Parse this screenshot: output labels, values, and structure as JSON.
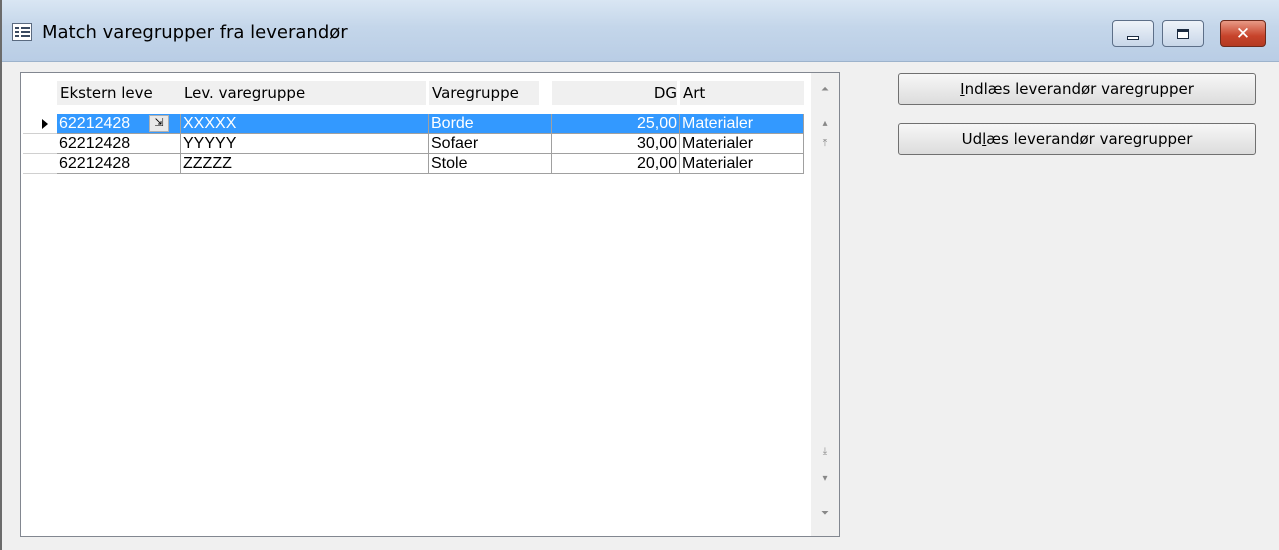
{
  "window": {
    "title": "Match varegrupper fra leverandør",
    "icon": "form-icon",
    "controls": {
      "minimize": "minimize-icon",
      "maximize": "maximize-icon",
      "close": "close-icon",
      "close_glyph": "✕"
    }
  },
  "grid": {
    "columns": [
      "Ekstern leve",
      "Lev. varegruppe",
      "Varegruppe",
      "DG",
      "Art"
    ],
    "rows": [
      {
        "ekstern": "62212428",
        "lev_varegruppe": "XXXXX",
        "varegruppe": "Borde",
        "dg": "25,00",
        "art": "Materialer",
        "selected": true
      },
      {
        "ekstern": "62212428",
        "lev_varegruppe": "YYYYY",
        "varegruppe": "Sofaer",
        "dg": "30,00",
        "art": "Materialer",
        "selected": false
      },
      {
        "ekstern": "62212428",
        "lev_varegruppe": "ZZZZZ",
        "varegruppe": "Stole",
        "dg": "20,00",
        "art": "Materialer",
        "selected": false
      }
    ],
    "lookup_glyph": "⇲",
    "scrollbar": {
      "top": "⏶",
      "up": "▴",
      "first": "⤒",
      "last": "⤓",
      "down": "▾",
      "bottom": "⏷"
    }
  },
  "actions": {
    "import_button": {
      "accel": "I",
      "rest": "ndlæs leverandør varegrupper"
    },
    "export_button": {
      "pre": "Ud",
      "accel": "l",
      "rest": "æs leverandør varegrupper"
    }
  }
}
